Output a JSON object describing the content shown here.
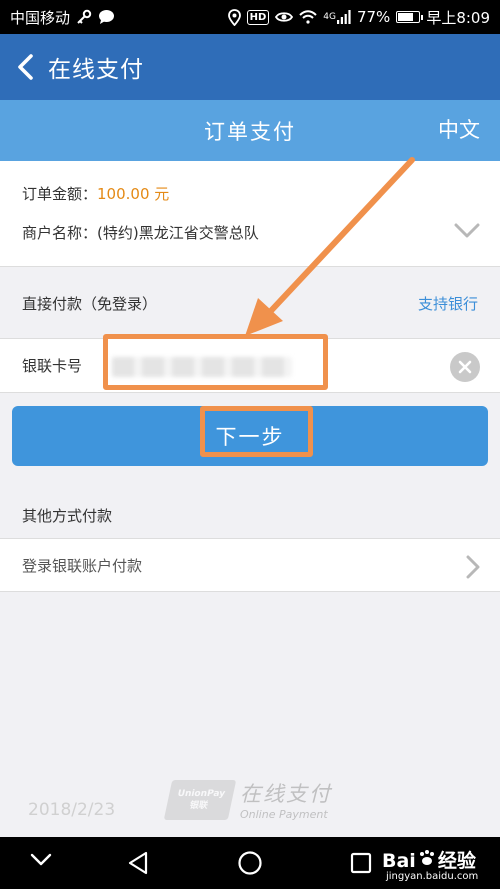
{
  "status_bar": {
    "carrier": "中国移动",
    "hd": "HD",
    "network": "4G",
    "battery": "77%",
    "battery_level": 0.77,
    "time": "早上8:09"
  },
  "app_bar": {
    "title": "在线支付"
  },
  "sub_header": {
    "title": "订单支付",
    "language": "中文"
  },
  "order": {
    "amount_label": "订单金额：",
    "amount_value": "100.00 元",
    "merchant_label": "商户名称：",
    "merchant_value": "(特约)黑龙江省交警总队"
  },
  "direct_pay": {
    "label": "直接付款（免登录）",
    "support_bank_link": "支持银行"
  },
  "card_field": {
    "label": "银联卡号"
  },
  "next_button": {
    "label": "下一步"
  },
  "other_methods": {
    "header": "其他方式付款",
    "login_option": "登录银联账户付款"
  },
  "footer": {
    "logo_line1": "UnionPay",
    "logo_line2": "银联",
    "text_main": "在线支付",
    "text_sub": "Online Payment"
  },
  "date_stamp": "2018/2/23",
  "watermark": {
    "brand_a": "Bai",
    "brand_b": "经验",
    "url": "jingyan.baidu.com"
  },
  "colors": {
    "app_bar": "#2f6db8",
    "sub_header": "#59a3e0",
    "next_button": "#3f95dc",
    "accent_amount": "#e48a16",
    "annotation": "#f0914c"
  }
}
